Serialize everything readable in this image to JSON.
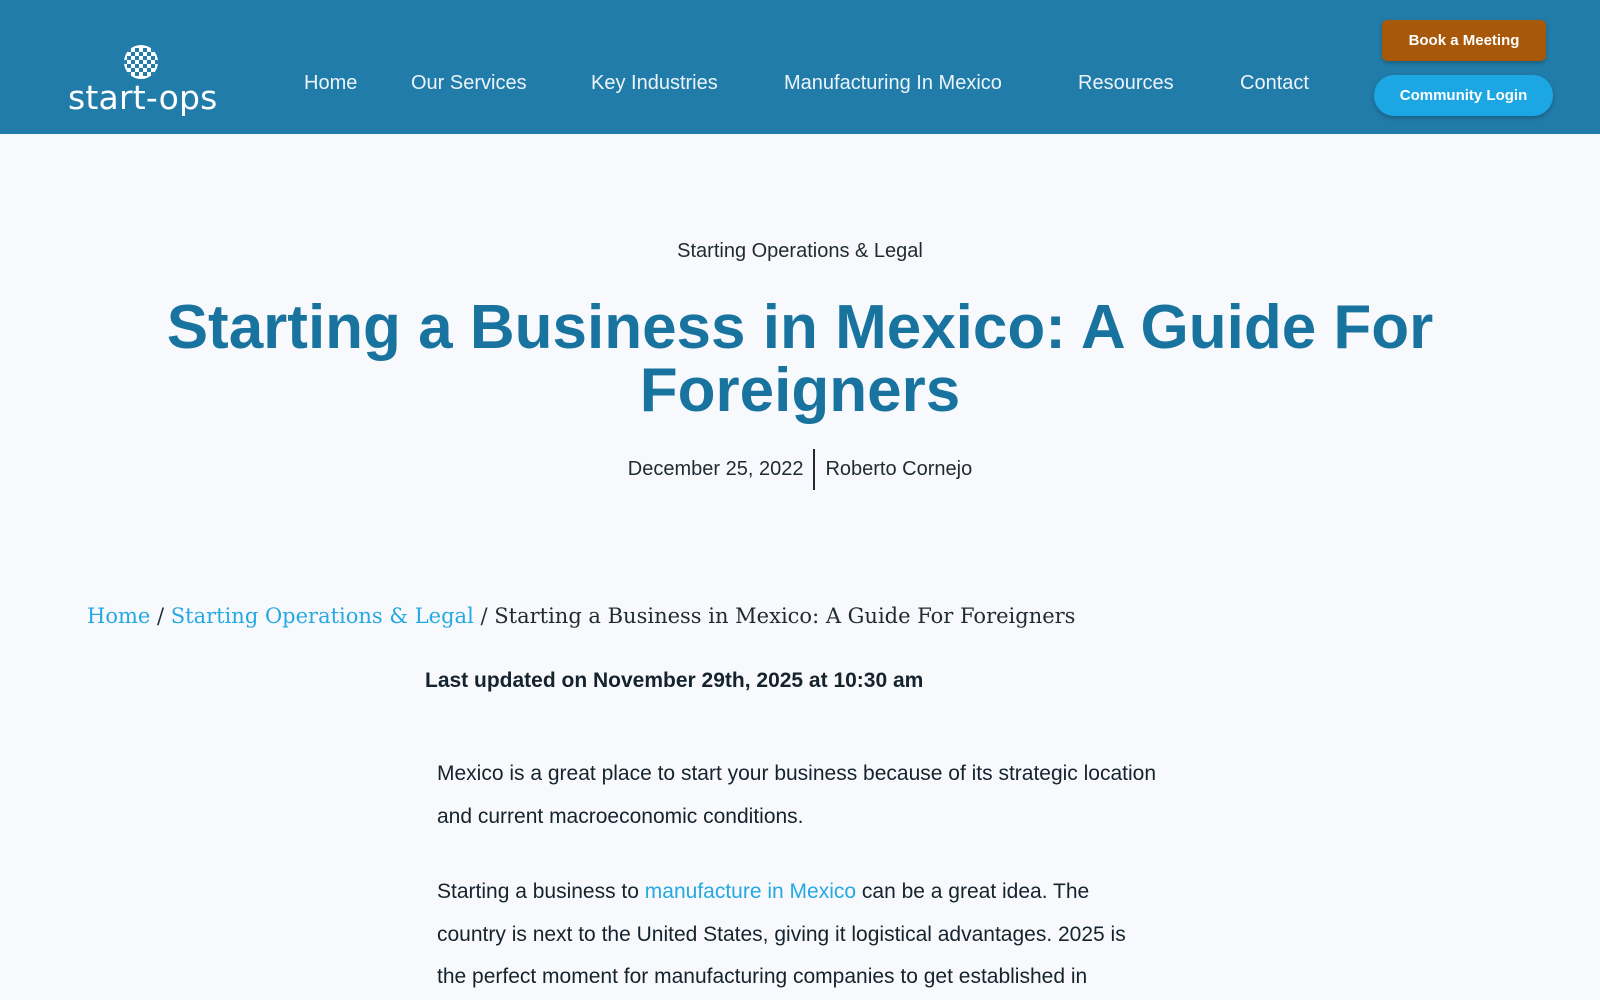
{
  "header": {
    "logo_text": "start-ops",
    "brand_color": "#227ca9",
    "nav": [
      {
        "label": "Home"
      },
      {
        "label": "Our Services"
      },
      {
        "label": "Key Industries"
      },
      {
        "label": "Manufacturing In Mexico"
      },
      {
        "label": "Resources"
      },
      {
        "label": "Contact"
      }
    ],
    "book_button": "Book a Meeting",
    "login_button": "Community Login"
  },
  "hero": {
    "category": "Starting Operations & Legal",
    "title": "Starting a Business in Mexico: A Guide For Foreigners",
    "date": "December 25, 2022",
    "author": "Roberto Cornejo"
  },
  "breadcrumb": {
    "home": "Home",
    "separator": "/",
    "category": "Starting Operations & Legal",
    "current": "Starting a Business in Mexico: A Guide For Foreigners"
  },
  "article": {
    "last_updated": "Last updated on November 29th, 2025 at 10:30 am",
    "para1": "Mexico is a great place to start your business because of its strategic location and current macroeconomic conditions.",
    "para2_before": "Starting a business to ",
    "para2_link": "manufacture in Mexico",
    "para2_after": " can be a great idea. The country is next to the United States, giving it logistical advantages. 2025 is the perfect moment for manufacturing companies to get established in"
  }
}
